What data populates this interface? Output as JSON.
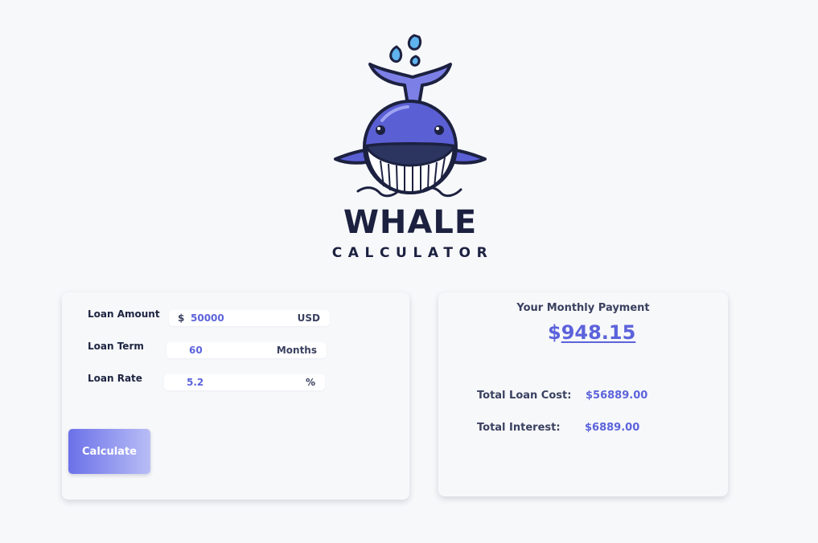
{
  "brand": {
    "name": "WHALE",
    "subtitle": "CALCULATOR"
  },
  "form": {
    "loan_amount": {
      "label": "Loan Amount",
      "prefix": "$",
      "value": "50000",
      "unit": "USD"
    },
    "loan_term": {
      "label": "Loan Term",
      "value": "60",
      "unit": "Months"
    },
    "loan_rate": {
      "label": "Loan Rate",
      "value": "5.2",
      "unit": "%"
    },
    "calculate_label": "Calculate"
  },
  "result": {
    "title": "Your Monthly Payment",
    "currency": "$",
    "monthly_payment": "948.15",
    "total_cost_label": "Total Loan Cost:",
    "total_cost_value": "$56889.00",
    "total_interest_label": "Total Interest:",
    "total_interest_value": "$6889.00"
  },
  "colors": {
    "accent": "#5c63db",
    "whale_body": "#5b5fd4",
    "text_dark": "#1c2140",
    "background": "#f7f8fa"
  },
  "icons": [
    "whale-logo-icon",
    "water-spout-icon"
  ]
}
